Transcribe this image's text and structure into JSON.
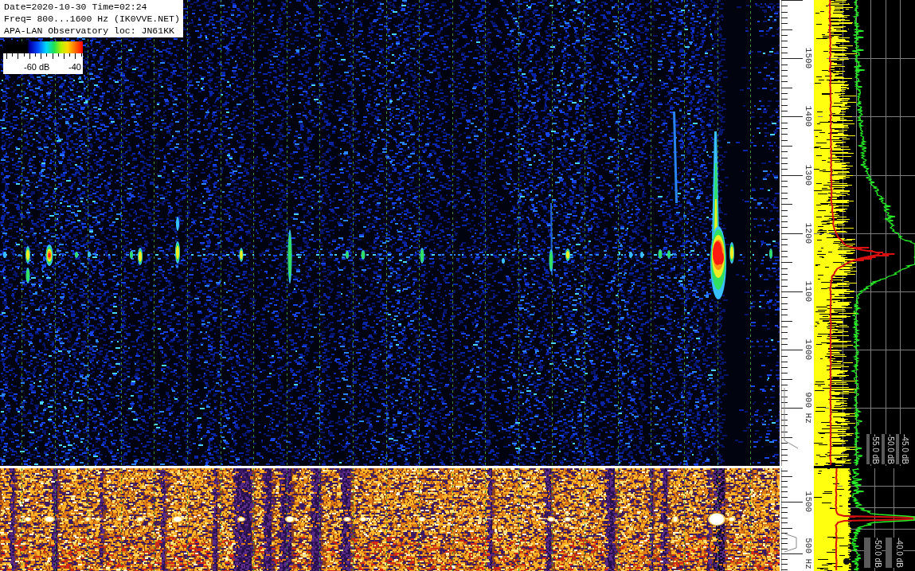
{
  "info_box": {
    "lines": [
      "Date=2020-10-30 Time=02:24",
      "Freq= 800...1600 Hz (IK0VVE.NET)",
      "APA-LAN Observatory loc: JN61KK"
    ]
  },
  "color_scale": {
    "labels": [
      "-60 dB",
      "-40"
    ]
  },
  "upper_panel": {
    "frequency_labels": [
      "1500",
      "1400",
      "1300",
      "1200",
      "1100",
      "1000",
      "900 Hz"
    ],
    "level_labels": [
      "-55.0 dB",
      "-50.0 dB",
      "-45.0 dB"
    ]
  },
  "lower_panel": {
    "frequency_labels": [
      "1500",
      "500 Hz"
    ],
    "level_labels": [
      "-50.0 dB",
      "-40.0 dB"
    ]
  }
}
